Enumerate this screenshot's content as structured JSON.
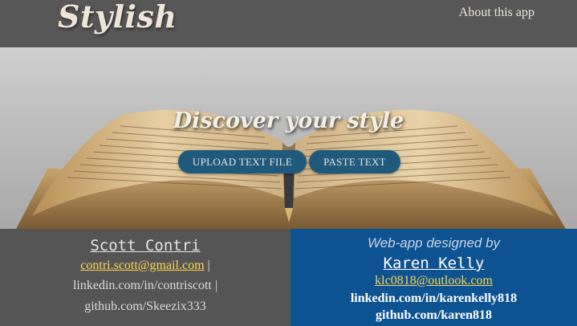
{
  "nav": {
    "brand": "Stylish",
    "about_link": "About this app"
  },
  "hero": {
    "tagline": "Discover your style",
    "upload_button": "UPLOAD TEXT FILE",
    "paste_button": "PASTE TEXT"
  },
  "footer_left": {
    "name": "Scott Contri",
    "email": "contri.scott@gmail.com",
    "separator": "|",
    "linkedin": "linkedin.com/in/contriscott |",
    "github": "github.com/Skeezix333"
  },
  "footer_right": {
    "heading": "Web-app designed by",
    "name": "Karen Kelly",
    "email": "klc0818@outlook.com",
    "linkedin": "linkedin.com/in/karenkelly818",
    "github": "github.com/karen818"
  },
  "colors": {
    "navbar": "#575757",
    "button": "#1f5a7d",
    "footer_left": "#555555",
    "footer_right": "#0d5291",
    "link_yellow": "#ffd452"
  }
}
